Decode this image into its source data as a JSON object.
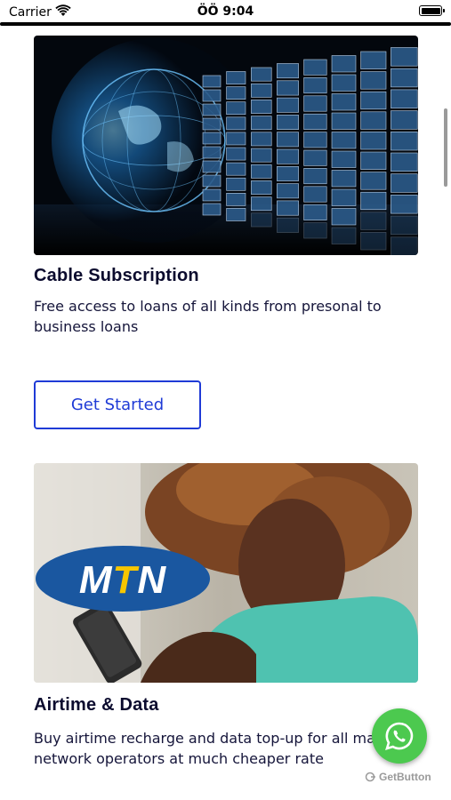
{
  "status_bar": {
    "carrier": "Carrier",
    "time": "ÖÖ 9:04"
  },
  "cards": [
    {
      "title": "Cable Subscription",
      "description": "Free access to loans of all kinds from presonal to business loans",
      "button_label": "Get Started",
      "image": "tv-wall-globe-image"
    },
    {
      "title": "Airtime & Data",
      "description": "Buy airtime recharge and data top-up for all major network operators at much cheaper rate",
      "image": "mtn-woman-phone-image",
      "logo_text": "MTN"
    }
  ],
  "floating": {
    "icon": "whatsapp-icon",
    "brand": "GetButton"
  },
  "colors": {
    "accent": "#1f3bd6",
    "title": "#0b0b2e",
    "whatsapp": "#4cc94f",
    "mtn_blue": "#1a57a0",
    "mtn_yellow": "#f7c600"
  }
}
